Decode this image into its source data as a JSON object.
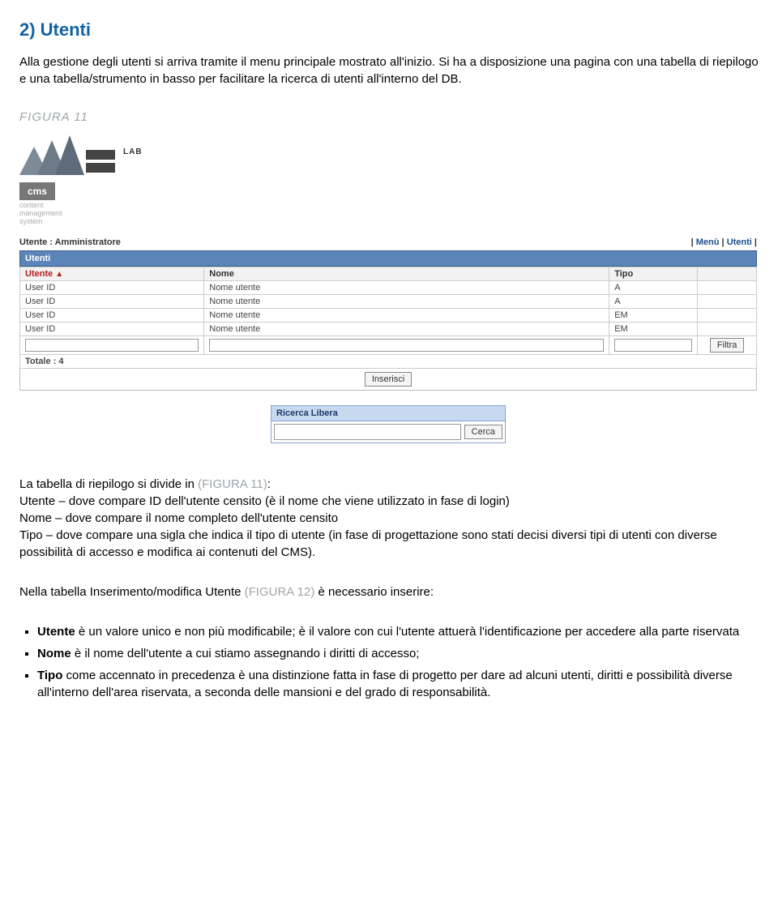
{
  "heading": "2) Utenti",
  "intro": "Alla gestione degli utenti si arriva tramite il menu principale mostrato all'inizio. Si ha a disposizione una pagina con una tabella di riepilogo e una tabella/strumento in basso per facilitare la ricerca di utenti all'interno del DB.",
  "figure11_label": "FIGURA 11",
  "screenshot": {
    "logo_sub": [
      "content",
      "management",
      "system"
    ],
    "cms": "cms",
    "lab": "LAB",
    "user_label": "Utente :",
    "user_value": "Amministratore",
    "nav_menu": "Menù",
    "nav_utenti": "Utenti",
    "panel_title": "Utenti",
    "columns": {
      "c1": "Utente",
      "c2": "Nome",
      "c3": "Tipo"
    },
    "rows": [
      {
        "u": "User ID",
        "n": "Nome utente",
        "t": "A"
      },
      {
        "u": "User ID",
        "n": "Nome utente",
        "t": "A"
      },
      {
        "u": "User ID",
        "n": "Nome utente",
        "t": "EM"
      },
      {
        "u": "User ID",
        "n": "Nome utente",
        "t": "EM"
      }
    ],
    "filter_btn": "Filtra",
    "total_label": "Totale : 4",
    "insert_btn": "Inserisci",
    "search_title": "Ricerca Libera",
    "search_btn": "Cerca"
  },
  "body2_pre": "La tabella di riepilogo si divide in ",
  "body2_ref": "(FIGURA 11)",
  "body2_post": ":",
  "line_utente": "Utente – dove compare ID dell'utente censito (è il nome che viene utilizzato in fase di login)",
  "line_nome": "Nome – dove compare il nome completo dell'utente censito",
  "line_tipo": "Tipo – dove compare una sigla che indica il tipo di utente (in fase di progettazione sono stati decisi diversi tipi di utenti con diverse possibilità di accesso e modifica ai contenuti del CMS).",
  "body3_pre": "Nella tabella Inserimento/modifica Utente ",
  "body3_ref": "(FIGURA 12)",
  "body3_post": " è necessario inserire:",
  "bullets": {
    "b1_strong": "Utente",
    "b1_rest": " è un valore unico e non più modificabile; è il valore con cui l'utente attuerà l'identificazione per accedere alla parte riservata",
    "b2_strong": "Nome",
    "b2_rest": " è il nome dell'utente a cui stiamo assegnando i diritti di accesso;",
    "b3_strong": "Tipo",
    "b3_rest": " come accennato in precedenza è una distinzione fatta in fase di progetto per dare ad alcuni utenti, diritti e possibilità diverse all'interno dell'area riservata, a seconda delle mansioni e del grado di responsabilità."
  }
}
